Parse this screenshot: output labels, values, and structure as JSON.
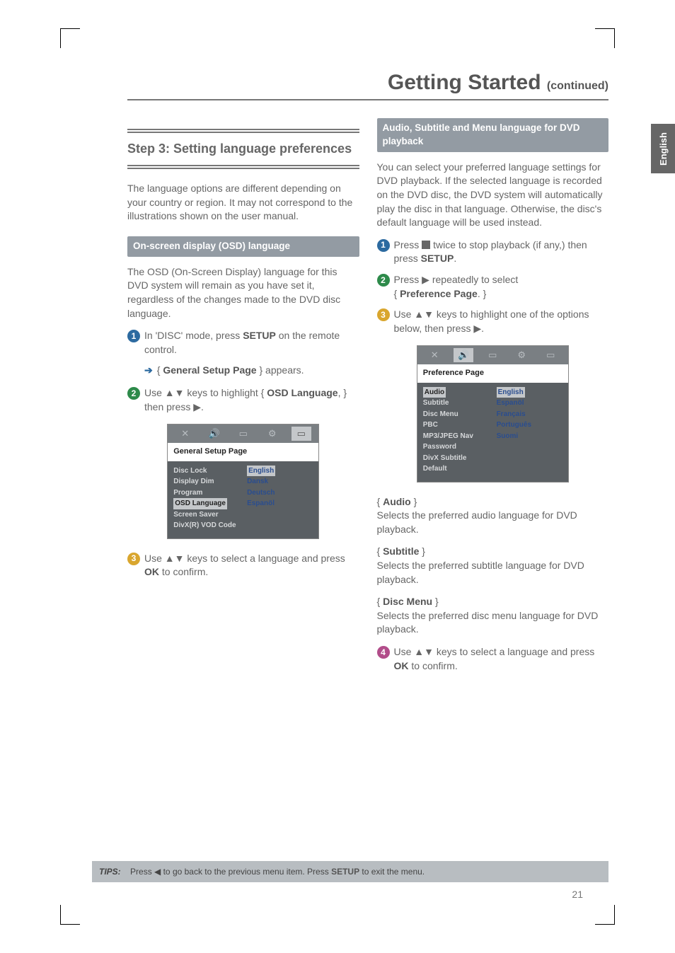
{
  "page_number": "21",
  "lang_tab": "English",
  "title_main": "Getting Started",
  "title_cont": "(continued)",
  "tips": {
    "label": "TIPS:",
    "before": "Press ",
    "after": " to go back to the previous menu item.  Press ",
    "btn": "SETUP",
    "tail": " to exit the menu."
  },
  "left": {
    "step_heading": "Step 3:  Setting language preferences",
    "intro": "The language options are different depending on your country or region.  It may not correspond to the illustrations shown on the user manual.",
    "sub1": "On-screen display (OSD) language",
    "para1": "The OSD (On-Screen Display) language for this DVD system will remain as you have set it, regardless of the changes made to the DVD disc language.",
    "s1a": "In 'DISC' mode, press ",
    "s1b": "SETUP",
    "s1c": " on the remote control.",
    "s1_sub_a": "{ ",
    "s1_sub_b": "General Setup Page",
    "s1_sub_c": " } appears.",
    "s2a": "Use ▲▼ keys to highlight { ",
    "s2b": "OSD Language",
    "s2c": ", } then press ▶.",
    "s3a": "Use ▲▼ keys to select a language and press ",
    "s3b": "OK",
    "s3c": " to confirm.",
    "menu": {
      "title": "General Setup Page",
      "left_items": [
        "Disc Lock",
        "Display Dim",
        "Program",
        "OSD Language",
        "Screen Saver",
        "DivX(R) VOD Code"
      ],
      "left_hl_index": 3,
      "right_items": [
        "English",
        "Dansk",
        "Deutsch",
        "Espanöl"
      ],
      "right_hl_index": 0
    }
  },
  "right": {
    "sub": "Audio, Subtitle and Menu language for DVD playback",
    "intro": "You can select your preferred language settings for DVD playback.  If the selected language is recorded on the DVD disc, the DVD system will automatically play the disc in that language.  Otherwise, the disc's default language will be used instead.",
    "s1a": "Press ",
    "s1b": " twice to stop playback (if any,) then press ",
    "s1c": "SETUP",
    "s1d": ".",
    "s2a": "Press ▶ repeatedly to select",
    "s2b": "{ ",
    "s2c": "Preference Page",
    "s2d": ". }",
    "s3a": "Use ▲▼ keys to highlight one of the options below, then press ▶.",
    "menu": {
      "title": "Preference Page",
      "left_items": [
        "Audio",
        "Subtitle",
        "Disc Menu",
        "PBC",
        "MP3/JPEG Nav",
        "Password",
        "DivX Subtitle",
        "Default"
      ],
      "left_hl_index": 0,
      "right_items": [
        "English",
        "Espanöl",
        "Français",
        "Português",
        "Suomi"
      ],
      "right_hl_index": 0
    },
    "opt1": {
      "name": "Audio",
      "desc": "Selects the preferred audio language for DVD playback."
    },
    "opt2": {
      "name": "Subtitle",
      "desc": "Selects the preferred subtitle language for DVD playback."
    },
    "opt3": {
      "name": "Disc Menu",
      "desc": "Selects the preferred disc menu language for DVD playback."
    },
    "s4a": "Use ▲▼ keys to select a language and press ",
    "s4b": "OK",
    "s4c": " to confirm."
  }
}
